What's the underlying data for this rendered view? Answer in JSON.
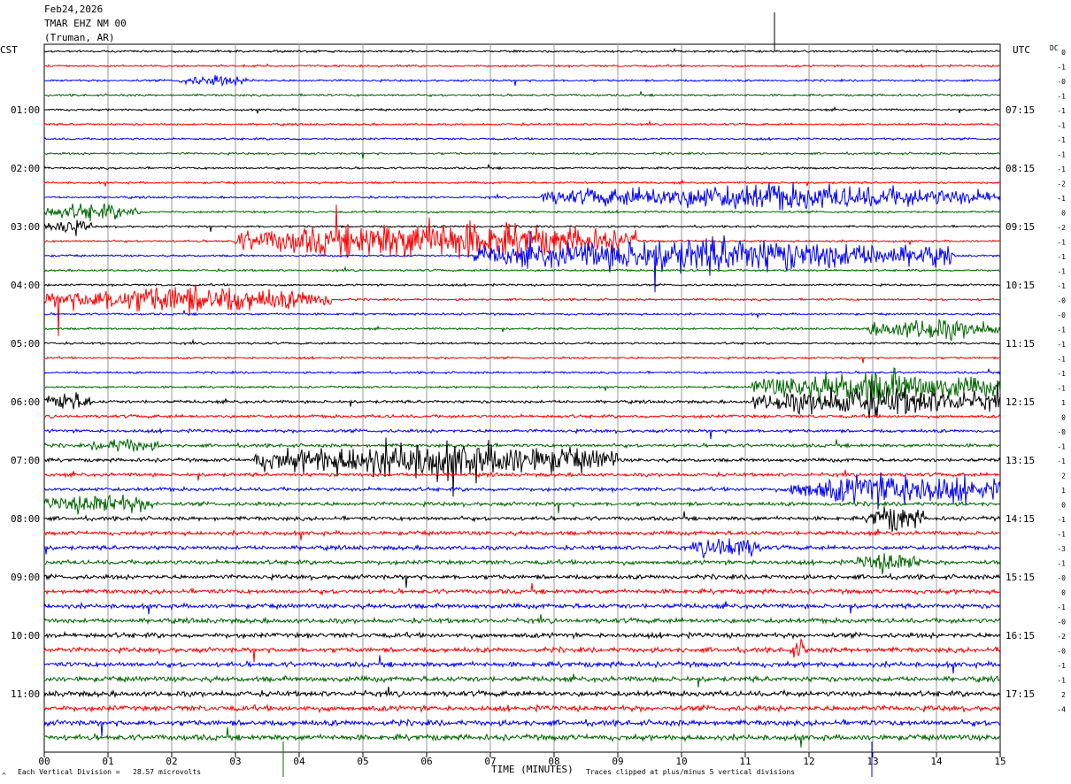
{
  "header": {
    "date": "Feb24,2026",
    "station": "TMAR EHZ NM 00",
    "location": "(Truman, AR)"
  },
  "left_tz": "CST",
  "right_tz": "UTC",
  "dc_label": "DC",
  "footer": {
    "scale_text": "Each Vertical Division =   28.57 microvolts",
    "clip_text": "Traces clipped at plus/minus 5 vertical divisions",
    "corner_mark": "^"
  },
  "chart_data": {
    "type": "line",
    "title": "",
    "xlabel": "TIME (MINUTES)",
    "ylabel": "",
    "xlim": [
      0,
      15
    ],
    "x_ticks": [
      "00",
      "01",
      "02",
      "03",
      "04",
      "05",
      "06",
      "07",
      "08",
      "09",
      "10",
      "11",
      "12",
      "13",
      "14",
      "15"
    ],
    "n_traces": 48,
    "minutes_per_trace": 15,
    "trace_colors": [
      "#000000",
      "#ff0000",
      "#0000ff",
      "#006600"
    ],
    "left_time_labels": [
      "01:00",
      "02:00",
      "03:00",
      "04:00",
      "05:00",
      "06:00",
      "07:00",
      "08:00",
      "09:00",
      "10:00",
      "11:00"
    ],
    "right_time_labels": [
      "07:15",
      "08:15",
      "09:15",
      "10:15",
      "11:15",
      "12:15",
      "13:15",
      "14:15",
      "15:15",
      "16:15",
      "17:15"
    ],
    "dc_offsets": [
      "0",
      "-1",
      "-0",
      "-1",
      "-1",
      "-1",
      "-1",
      "-1",
      "-1",
      "-2",
      "-1",
      "0",
      "-2",
      "-1",
      "-1",
      "-1",
      "-1",
      "-0",
      "-0",
      "-1",
      "-1",
      "-1",
      "-1",
      "-1",
      "1",
      "0",
      "-0",
      "-1",
      "-1",
      "2",
      "1",
      "0",
      "-1",
      "-1",
      "-3",
      "-1",
      "-0",
      "0",
      "-1",
      "-0",
      "-2",
      "-0",
      "-1",
      "-1",
      "2",
      "-4"
    ],
    "scale_microvolts_per_division": 28.57,
    "clip_divisions": 5,
    "grid": true
  }
}
